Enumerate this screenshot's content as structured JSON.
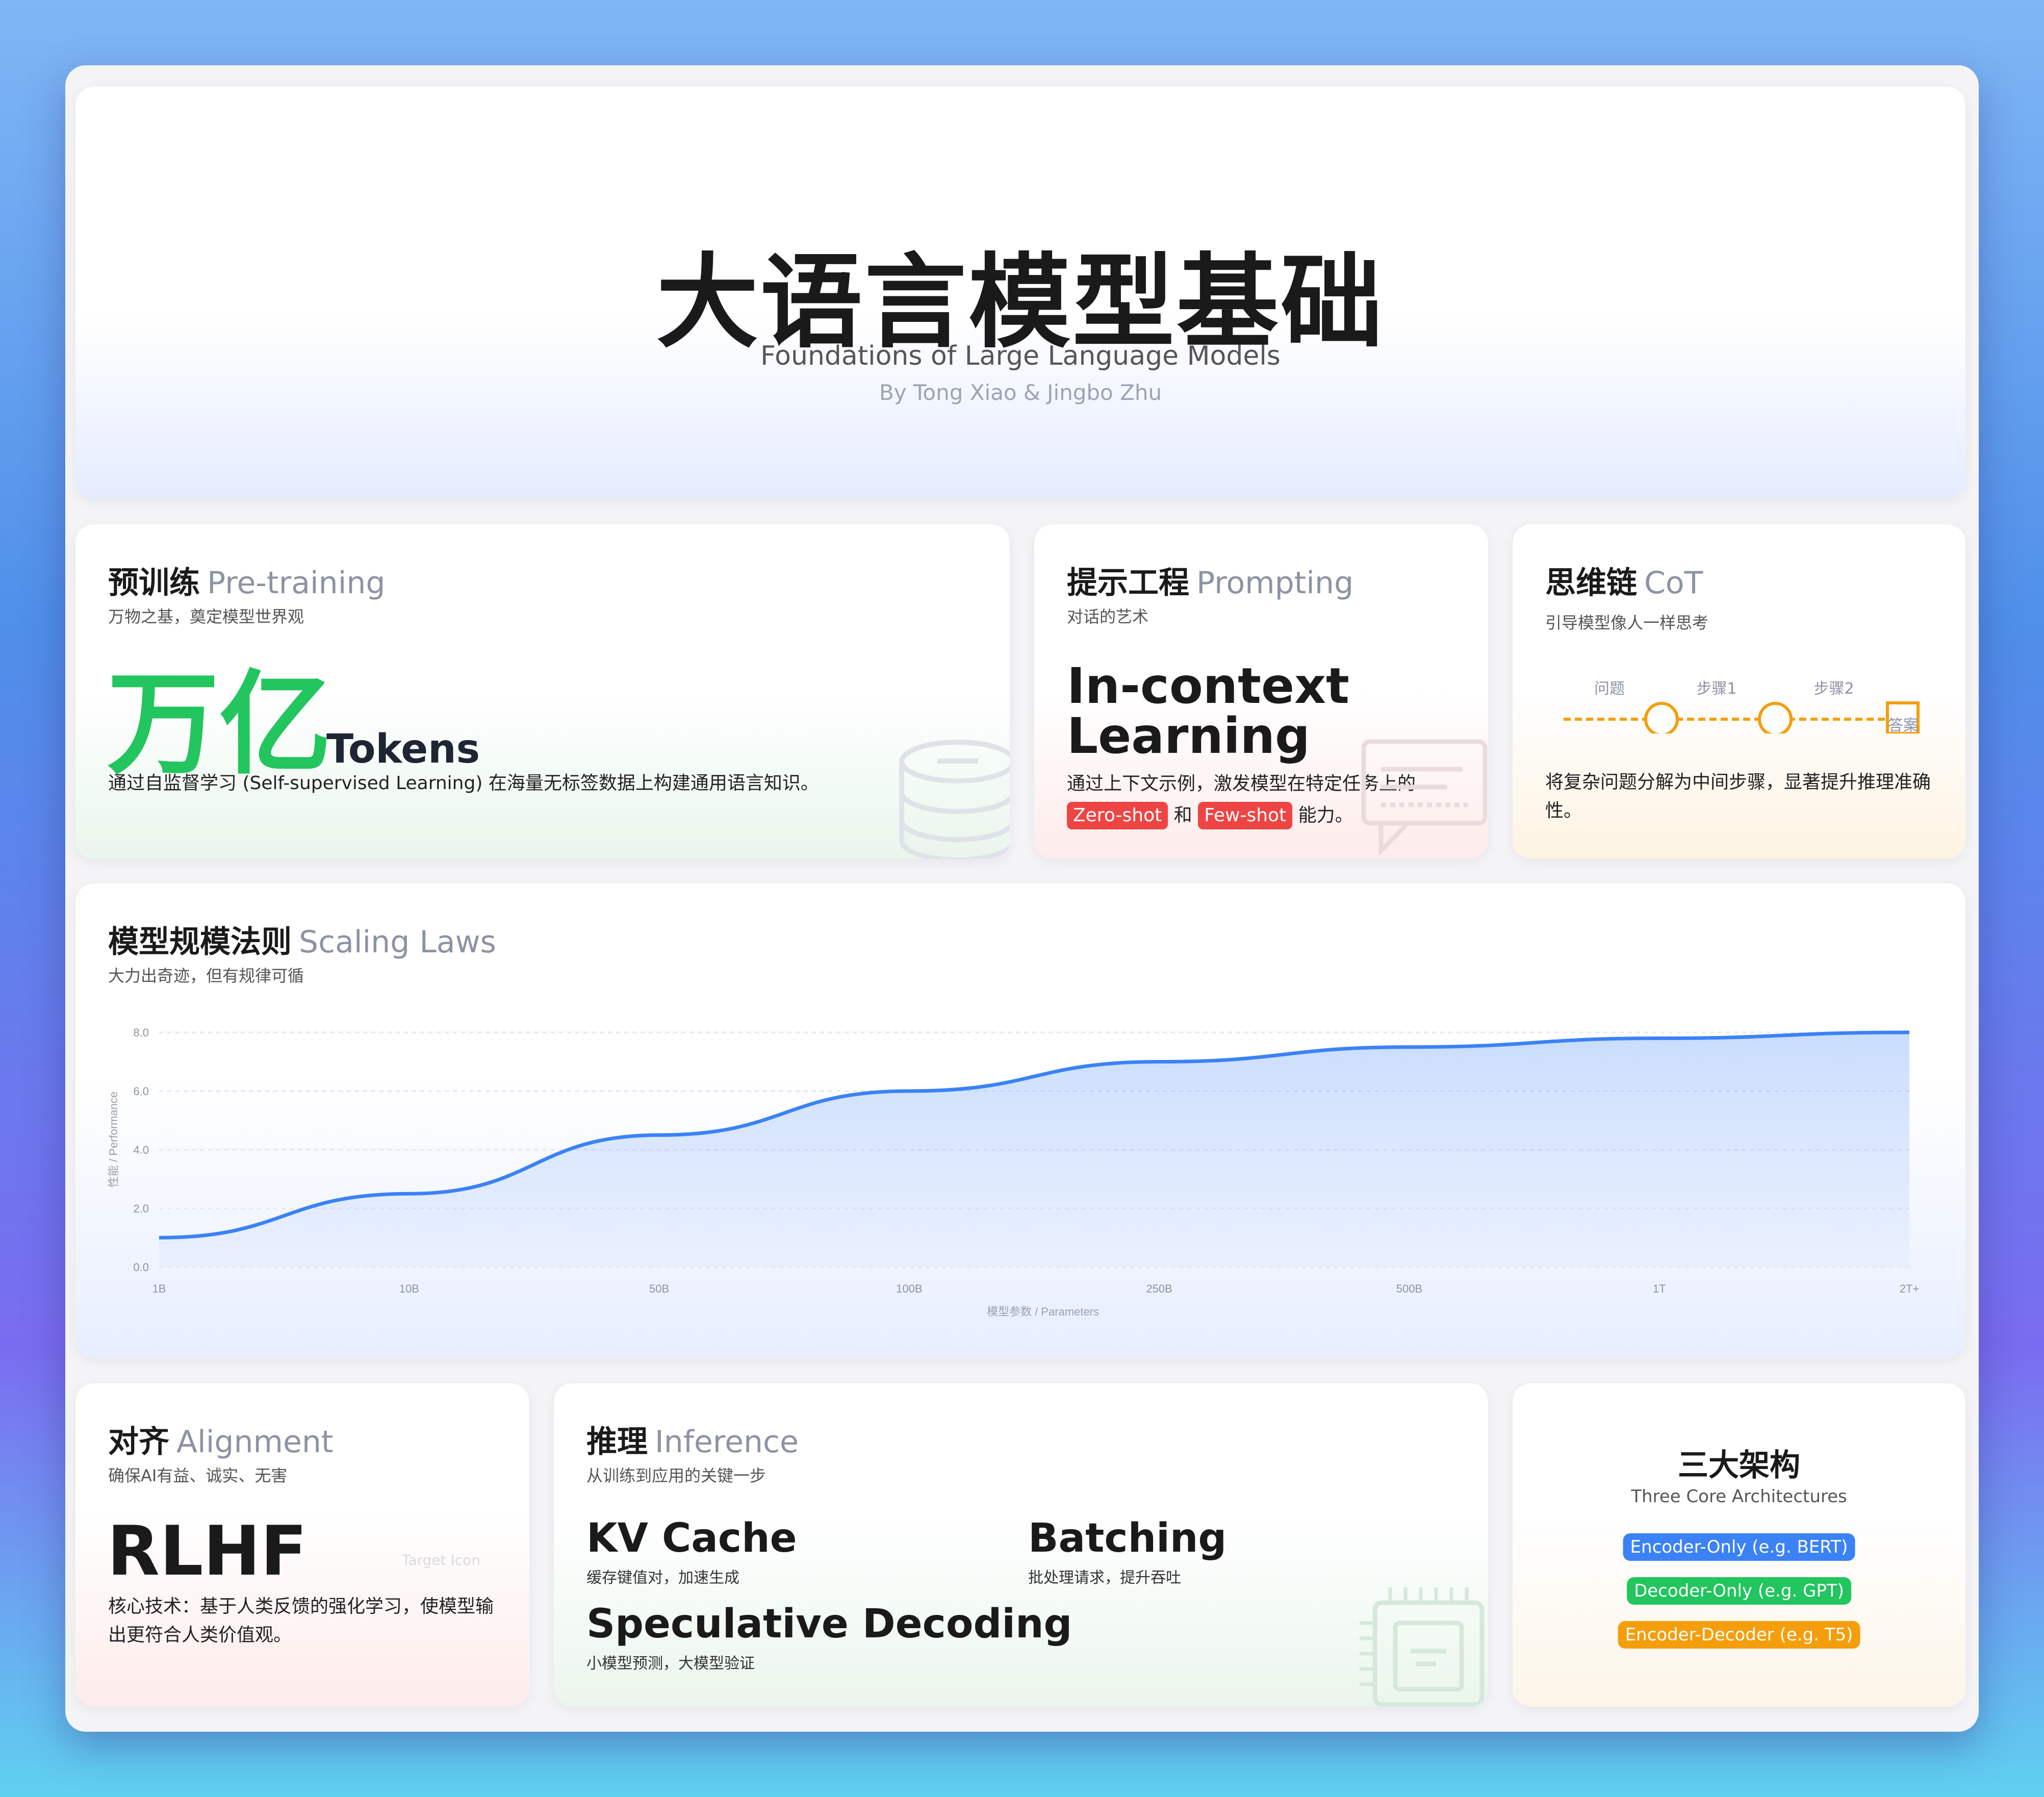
{
  "hero": {
    "title": "大语言模型基础",
    "subtitle": "Foundations of Large Language Models",
    "byline": "By Tong Xiao & Jingbo Zhu"
  },
  "pretraining": {
    "title_zh": "预训练",
    "title_en": "Pre-training",
    "desc": "万物之基，奠定模型世界观",
    "big": "万亿",
    "unit": "Tokens",
    "body": "通过自监督学习 (Self-supervised Learning) 在海量无标签数据上构建通用语言知识。",
    "icon": "database-icon"
  },
  "prompting": {
    "title_zh": "提示工程",
    "title_en": "Prompting",
    "desc": "对话的艺术",
    "big_line1": "In-context",
    "big_line2": "Learning",
    "body_pre": "通过上下文示例，激发模型在特定任务上的",
    "tag1": "Zero-shot",
    "join": "和",
    "tag2": "Few-shot",
    "body_post": "能力。",
    "icon": "chat-bubble-icon"
  },
  "cot": {
    "title_zh": "思维链",
    "title_en": "CoT",
    "desc": "引导模型像人一样思考",
    "step_question": "问题",
    "step1": "步骤1",
    "step2": "步骤2",
    "step_answer": "答案",
    "body": "将复杂问题分解为中间步骤，显著提升推理准确性。"
  },
  "scaling": {
    "title_zh": "模型规模法则",
    "title_en": "Scaling Laws",
    "desc": "大力出奇迹，但有规律可循"
  },
  "chart_data": {
    "type": "area",
    "categories": [
      "1B",
      "10B",
      "50B",
      "100B",
      "250B",
      "500B",
      "1T",
      "2T+"
    ],
    "values": [
      1.0,
      2.5,
      4.5,
      6.0,
      7.0,
      7.5,
      7.8,
      8.0
    ],
    "xlabel": "模型参数 / Parameters",
    "ylabel": "性能 / Performance",
    "ylim": [
      0,
      8
    ],
    "yticks": [
      "0.0",
      "2.0",
      "4.0",
      "6.0",
      "8.0"
    ],
    "grid": true,
    "color": "#3b82f6"
  },
  "alignment": {
    "title_zh": "对齐",
    "title_en": "Alignment",
    "desc": "确保AI有益、诚实、无害",
    "big": "RLHF",
    "body": "核心技术：基于人类反馈的强化学习，使模型输出更符合人类价值观。",
    "ghost": "Target Icon"
  },
  "inference": {
    "title_zh": "推理",
    "title_en": "Inference",
    "desc": "从训练到应用的关键一步",
    "items": [
      {
        "name": "KV Cache",
        "desc": "缓存键值对，加速生成"
      },
      {
        "name": "Batching",
        "desc": "批处理请求，提升吞吐"
      },
      {
        "name": "Speculative Decoding",
        "desc": "小模型预测，大模型验证"
      }
    ],
    "icon": "chip-icon"
  },
  "architectures": {
    "title": "三大架构",
    "subtitle": "Three Core Architectures",
    "tags": [
      {
        "label": "Encoder-Only (e.g. BERT)",
        "color": "#3b82f6"
      },
      {
        "label": "Decoder-Only (e.g. GPT)",
        "color": "#22c55e"
      },
      {
        "label": "Encoder-Decoder (e.g. T5)",
        "color": "#f59e0b"
      }
    ]
  }
}
